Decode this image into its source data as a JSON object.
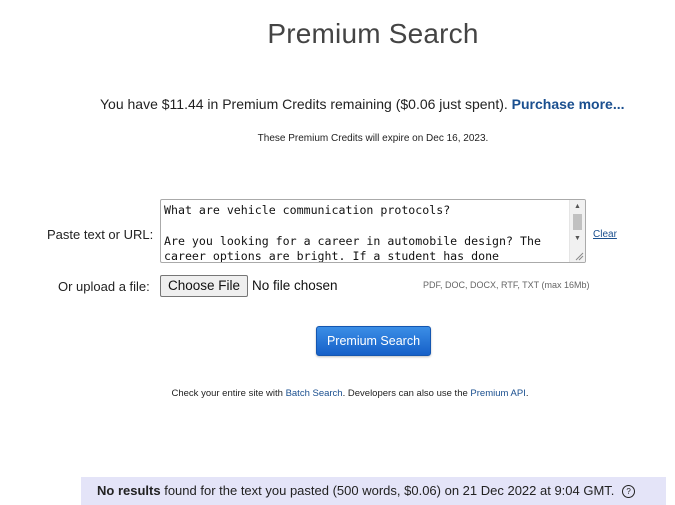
{
  "page": {
    "title": "Premium Search"
  },
  "credits": {
    "text": "You have $11.44 in Premium Credits remaining ($0.06 just spent).",
    "purchase_link": "Purchase more...",
    "expiry": "These Premium Credits will expire on Dec 16, 2023."
  },
  "form": {
    "paste_label": "Paste text or URL:",
    "textarea_value": "What are vehicle communication protocols?\n\nAre you looking for a career in automobile design? The career options are bright. If a student has done",
    "clear_link": "Clear",
    "upload_label": "Or upload a file:",
    "choose_file_button": "Choose File",
    "no_file_text": "No file chosen",
    "formats_hint": "PDF, DOC, DOCX, RTF, TXT (max 16Mb)",
    "submit_button": "Premium Search"
  },
  "footer_links": {
    "prefix": "Check your entire site with",
    "batch_link": "Batch Search",
    "middle": ". Developers can also use the",
    "api_link": "Premium API",
    "suffix": "."
  },
  "result": {
    "bold": "No results",
    "text": "found for the text you pasted (500 words, $0.06) on 21 Dec 2022 at 9:04 GMT.",
    "help_icon": "?"
  },
  "colors": {
    "link": "#1a4f8f",
    "button": "#1660c8",
    "result_bg": "#e4e4f8"
  }
}
